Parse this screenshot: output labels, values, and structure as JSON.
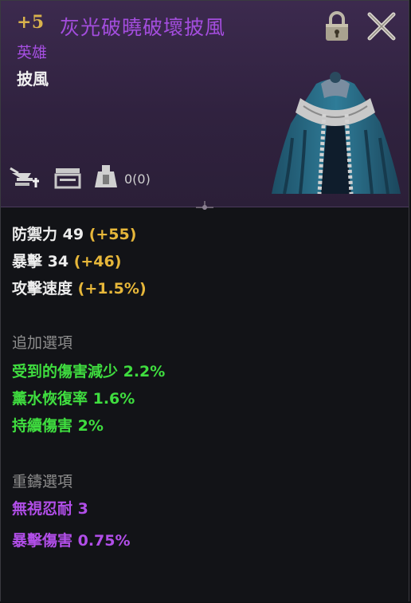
{
  "header": {
    "enhance_level": "+5",
    "item_name": "灰光破曉破壞披風",
    "grade": "英雄",
    "category": "披風",
    "durability_count": "0(0)"
  },
  "icons": {
    "lock": "lock-icon",
    "close": "close-icon",
    "enhance": "anvil-plus-icon",
    "chest": "chest-icon",
    "weight": "weight-icon",
    "item": "cloak-image"
  },
  "stats": [
    {
      "label": "防禦力 49",
      "bonus": "(+55)"
    },
    {
      "label": "暴擊 34",
      "bonus": "(+46)"
    },
    {
      "label": "攻擊速度",
      "bonus": "(+1.5%)"
    }
  ],
  "additional_options": {
    "title": "追加選項",
    "items": [
      "受到的傷害減少 2.2%",
      "薰水恢復率 1.6%",
      "持續傷害 2%"
    ]
  },
  "reforge_options": {
    "title": "重鑄選項",
    "items": [
      "無視忍耐 3",
      "暴擊傷害 0.75%"
    ]
  },
  "colors": {
    "header_bg": "#30223f",
    "body_bg": "#121317",
    "enhance": "#d9b24c",
    "name": "#a34ddd",
    "bonus": "#e7b73a",
    "green": "#3fdd3f",
    "purple": "#b14ee8"
  }
}
